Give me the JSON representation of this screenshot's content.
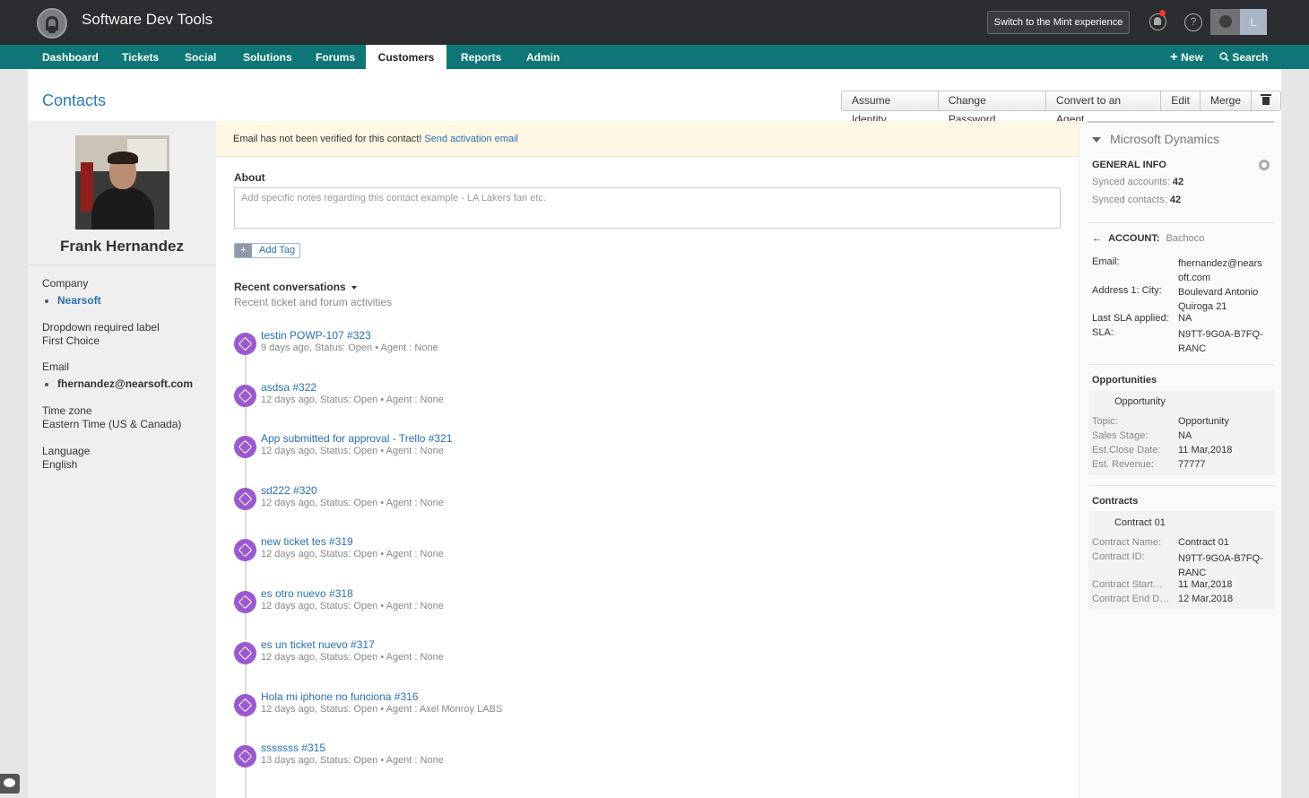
{
  "app": {
    "title": "Software Dev Tools",
    "mint_button": "Switch to the Mint experience",
    "help_glyph": "?",
    "avatar_letter": "L"
  },
  "nav": {
    "items": [
      "Dashboard",
      "Tickets",
      "Social",
      "Solutions",
      "Forums",
      "Customers",
      "Reports",
      "Admin"
    ],
    "active": "Customers",
    "new_label": "New",
    "search_label": "Search"
  },
  "page": {
    "title": "Contacts",
    "actions": [
      "Assume Identity",
      "Change Password",
      "Convert to an Agent",
      "Edit",
      "Merge"
    ]
  },
  "contact": {
    "name": "Frank Hernandez",
    "fields": [
      {
        "label": "Company",
        "value": "Nearsoft",
        "bullet": true,
        "link": true
      },
      {
        "label": "Dropdown required label",
        "value": "First Choice"
      },
      {
        "label": "Email",
        "value": "fhernandez@nearsoft.com",
        "bullet": true
      },
      {
        "label": "Time zone",
        "value": "Eastern Time (US & Canada)"
      },
      {
        "label": "Language",
        "value": "English"
      }
    ]
  },
  "alert": {
    "text": "Email has not been verified for this contact!",
    "link": "Send activation email"
  },
  "about": {
    "label": "About",
    "placeholder": "Add specific notes regarding this contact example - LA Lakers fan etc."
  },
  "tag": {
    "plus": "+",
    "label": "Add Tag"
  },
  "recent": {
    "title": "Recent conversations",
    "subtitle": "Recent ticket and forum activities",
    "items": [
      {
        "title": "testin POWP-107 #323",
        "meta": "9 days ago, Status: Open  •  Agent : None"
      },
      {
        "title": "asdsa #322",
        "meta": "12 days ago, Status: Open  •  Agent : None"
      },
      {
        "title": "App submitted for approval - Trello #321",
        "meta": "12 days ago, Status: Open  •  Agent : None"
      },
      {
        "title": "sd222 #320",
        "meta": "12 days ago, Status: Open  •  Agent : None"
      },
      {
        "title": "new ticket tes #319",
        "meta": "12 days ago, Status: Open  •  Agent : None"
      },
      {
        "title": "es otro nuevo #318",
        "meta": "12 days ago, Status: Open  •  Agent : None"
      },
      {
        "title": "es un ticket nuevo #317",
        "meta": "12 days ago, Status: Open  •  Agent : None"
      },
      {
        "title": "Hola mi iphone no funciona #316",
        "meta": "12 days ago, Status: Open  •  Agent : Axel Monroy LABS"
      },
      {
        "title": "sssssss #315",
        "meta": "13 days ago, Status: Open  •  Agent : None"
      }
    ]
  },
  "dynamics": {
    "header": "Microsoft Dynamics",
    "general_info": "GENERAL INFO",
    "synced_accounts_label": "Synced accounts:",
    "synced_accounts": "42",
    "synced_contacts_label": "Synced contacts:",
    "synced_contacts": "42",
    "account_label": "ACCOUNT:",
    "account_name": "Bachoco",
    "account_fields": [
      {
        "label": "Email:",
        "value": "fhernandez@nears oft.com"
      },
      {
        "label": "Address 1: City:",
        "value": "Boulevard Antonio Quiroga 21"
      },
      {
        "label": "Last SLA applied:",
        "value": "NA"
      },
      {
        "label": "SLA:",
        "value": "N9TT-9G0A-B7FQ-RANC"
      }
    ],
    "opportunities_title": "Opportunities",
    "opportunity_name": "Opportunity",
    "opportunity_fields": [
      {
        "label": "Topic:",
        "value": "Opportunity"
      },
      {
        "label": "Sales Stage:",
        "value": "NA"
      },
      {
        "label": "Est.Close Date:",
        "value": "11 Mar,2018"
      },
      {
        "label": "Est. Revenue:",
        "value": "77777"
      }
    ],
    "contracts_title": "Contracts",
    "contract_name": "Contract 01",
    "contract_fields": [
      {
        "label": "Contract Name:",
        "value": "Contract 01"
      },
      {
        "label": "Contract ID:",
        "value": "N9TT-9G0A-B7FQ-RANC"
      },
      {
        "label": "Contract Start…",
        "value": "11 Mar,2018"
      },
      {
        "label": "Contract End D…",
        "value": "12 Mar,2018"
      }
    ]
  }
}
